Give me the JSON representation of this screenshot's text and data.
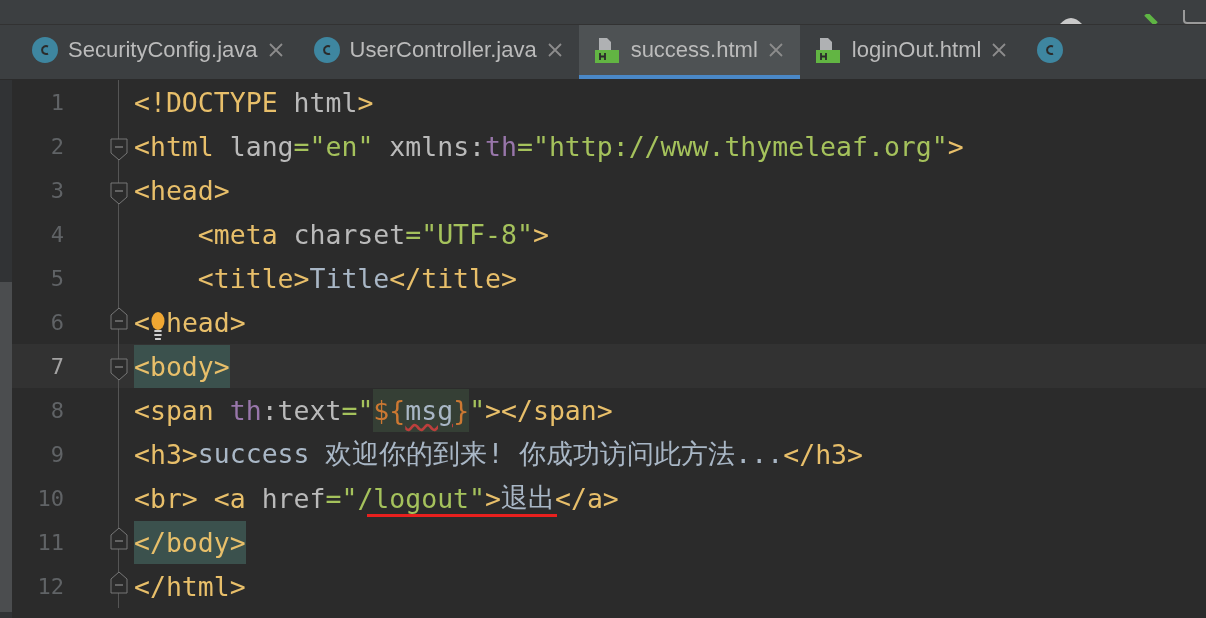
{
  "tabs": [
    {
      "label": "SecurityConfig.java",
      "kind": "java",
      "selected": false
    },
    {
      "label": "UserController.java",
      "kind": "java",
      "selected": false
    },
    {
      "label": "success.html",
      "kind": "html",
      "selected": true
    },
    {
      "label": "loginOut.html",
      "kind": "html",
      "selected": false
    },
    {
      "kind": "java",
      "selected": false,
      "clipped": true
    }
  ],
  "lines": [
    {
      "number": "1",
      "current": false,
      "tokens": [
        {
          "t": "<!DOCTYPE ",
          "kind": "tag"
        },
        {
          "t": "html",
          "kind": "attr"
        },
        {
          "t": ">",
          "kind": "tag"
        }
      ]
    },
    {
      "number": "2",
      "current": false,
      "fold": {
        "kind": "start"
      },
      "tokens": [
        {
          "t": "<html ",
          "kind": "tag"
        },
        {
          "t": "lang",
          "kind": "attr"
        },
        {
          "t": "=",
          "kind": "str"
        },
        {
          "t": "\"en\" ",
          "kind": "str"
        },
        {
          "t": "xmlns:",
          "kind": "attr"
        },
        {
          "t": "th",
          "kind": "ns"
        },
        {
          "t": "=\"http://www.thymeleaf.org\"",
          "kind": "str"
        },
        {
          "t": ">",
          "kind": "tag"
        }
      ]
    },
    {
      "number": "3",
      "current": false,
      "fold": {
        "kind": "start"
      },
      "tokens": [
        {
          "t": "<head>",
          "kind": "tag"
        }
      ]
    },
    {
      "number": "4",
      "current": false,
      "indented": true,
      "tokens": [
        {
          "t": "<meta ",
          "kind": "tag"
        },
        {
          "t": "charset",
          "kind": "attr"
        },
        {
          "t": "=\"UTF-8\"",
          "kind": "str"
        },
        {
          "t": ">",
          "kind": "tag"
        }
      ]
    },
    {
      "number": "5",
      "current": false,
      "indented": true,
      "tokens": [
        {
          "t": "<title>",
          "kind": "tag"
        },
        {
          "t": "Title",
          "kind": "text"
        },
        {
          "t": "</title>",
          "kind": "tag"
        }
      ]
    },
    {
      "number": "6",
      "current": false,
      "fold": {
        "kind": "end"
      },
      "tokens": [
        {
          "t": "<",
          "kind": "tag"
        },
        {
          "kind": "bulb"
        },
        {
          "t": "head>",
          "kind": "tag"
        }
      ]
    },
    {
      "number": "7",
      "current": true,
      "fold": {
        "kind": "start"
      },
      "tokens": [
        {
          "t": "<body>",
          "kind": "tagmatch"
        }
      ]
    },
    {
      "number": "8",
      "current": false,
      "tokens": [
        {
          "t": "<span ",
          "kind": "tag"
        },
        {
          "t": "th",
          "kind": "ns"
        },
        {
          "t": ":text",
          "kind": "attr"
        },
        {
          "t": "=\"",
          "kind": "str"
        },
        {
          "t": "${",
          "kind": "inject"
        },
        {
          "t": "msg",
          "kind": "warn"
        },
        {
          "t": "}",
          "kind": "inject"
        },
        {
          "t": "\"",
          "kind": "str"
        },
        {
          "t": "></span>",
          "kind": "tag"
        }
      ]
    },
    {
      "number": "9",
      "current": false,
      "tokens": [
        {
          "t": "<h3>",
          "kind": "tag"
        },
        {
          "t": "success 欢迎你的到来! 你成功访问此方法...",
          "kind": "text"
        },
        {
          "t": "</h3>",
          "kind": "tag"
        }
      ]
    },
    {
      "number": "10",
      "current": false,
      "underline": true,
      "tokens": [
        {
          "t": "<br> <a ",
          "kind": "tag"
        },
        {
          "t": "href",
          "kind": "attr"
        },
        {
          "t": "=\"/logout\"",
          "kind": "str"
        },
        {
          "t": ">",
          "kind": "tag"
        },
        {
          "t": "退出",
          "kind": "text"
        },
        {
          "t": "</a>",
          "kind": "tag"
        }
      ]
    },
    {
      "number": "11",
      "current": false,
      "fold": {
        "kind": "end"
      },
      "tokens": [
        {
          "t": "</body>",
          "kind": "tagmatch"
        }
      ]
    },
    {
      "number": "12",
      "current": false,
      "fold": {
        "kind": "end"
      },
      "tokens": [
        {
          "t": "</html>",
          "kind": "tag"
        }
      ]
    }
  ]
}
